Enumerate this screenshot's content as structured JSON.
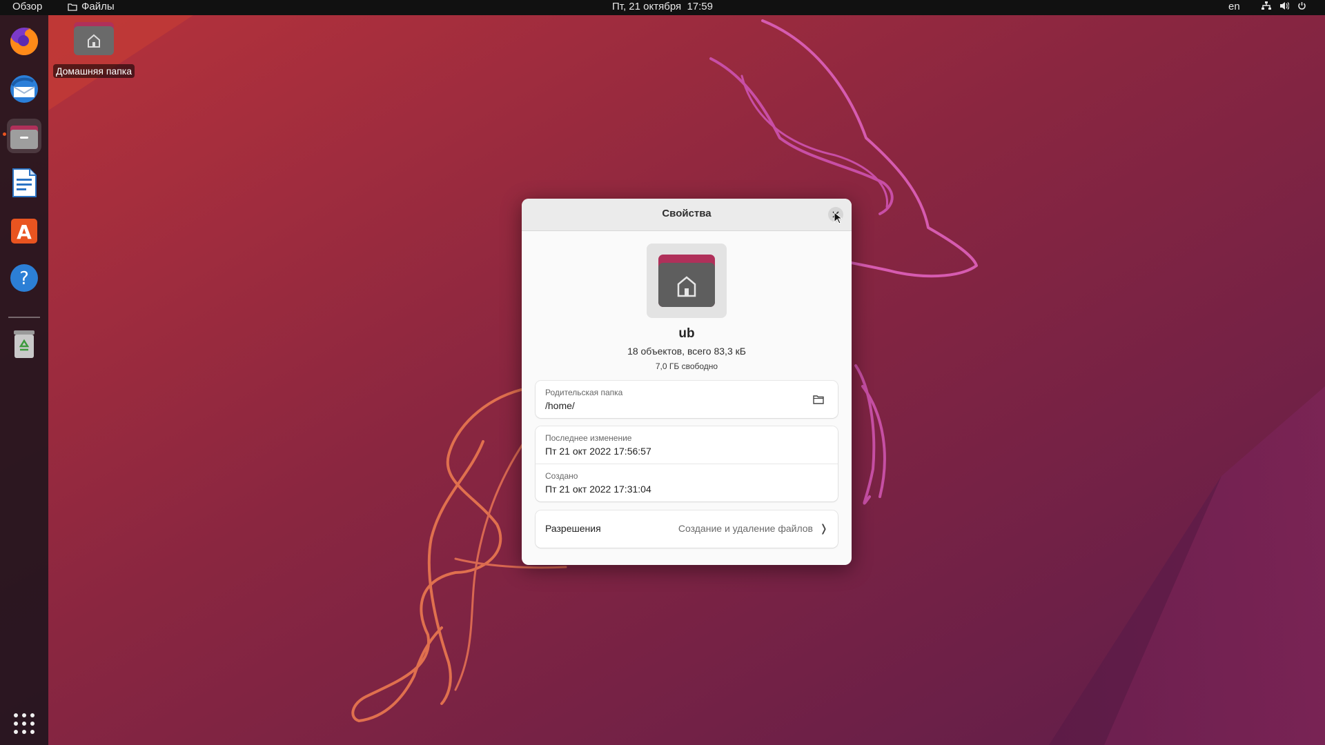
{
  "topbar": {
    "overview_label": "Обзор",
    "app_name": "Файлы",
    "clock": "Пт, 21 октября  17:59",
    "language": "en",
    "tray_icons": [
      "network-icon",
      "volume-icon",
      "power-icon"
    ]
  },
  "dock": {
    "items": [
      {
        "name": "firefox-icon",
        "active": false
      },
      {
        "name": "thunderbird-icon",
        "active": false
      },
      {
        "name": "files-icon",
        "active": true
      },
      {
        "name": "writer-icon",
        "active": false
      },
      {
        "name": "software-center-icon",
        "active": false
      },
      {
        "name": "help-icon",
        "active": false
      },
      {
        "name": "trash-icon",
        "active": false
      },
      {
        "name": "show-apps-icon",
        "active": false
      }
    ]
  },
  "desktop": {
    "home_folder_label": "Домашняя папка"
  },
  "dialog": {
    "title": "Свойства",
    "close_icon": "close-icon",
    "folder_name": "ub",
    "contents": "18 объектов, всего 83,3 кБ",
    "free_space": "7,0 ГБ свободно",
    "parent": {
      "label": "Родительская папка",
      "value": "/home/"
    },
    "modified": {
      "label": "Последнее изменение",
      "value": "Пт 21 окт 2022 17:56:57"
    },
    "created": {
      "label": "Создано",
      "value": "Пт 21 окт 2022 17:31:04"
    },
    "permissions": {
      "label": "Разрешения",
      "value": "Создание и удаление файлов"
    }
  },
  "colors": {
    "accent": "#e95420",
    "folder_top": "#b0305a",
    "folder_body": "#5e5e5e"
  }
}
